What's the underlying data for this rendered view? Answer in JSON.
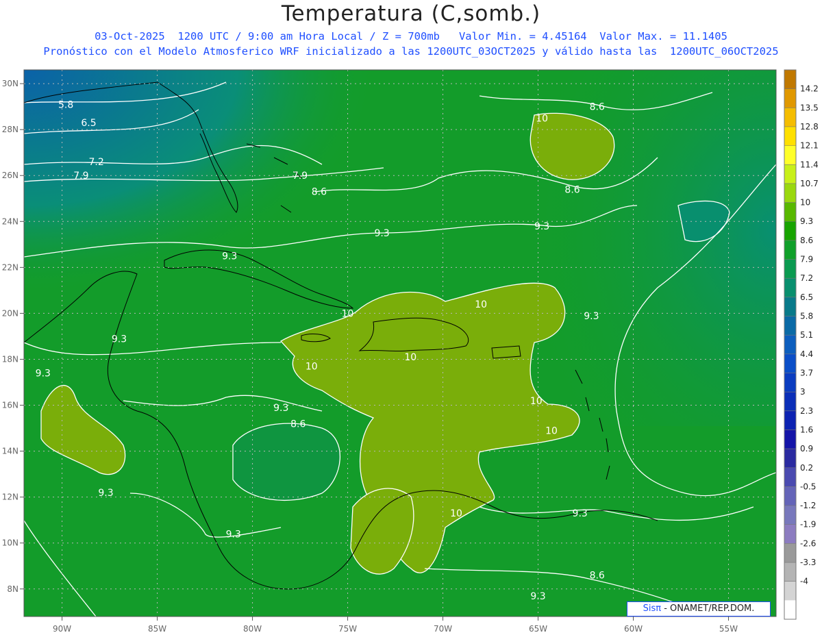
{
  "title": "Temperatura (C,somb.)",
  "subtitle1": "03-Oct-2025  1200 UTC / 9:00 am Hora Local / Z = 700mb   Valor Min. = 4.45164  Valor Max. = 11.1405",
  "subtitle2": "Pronóstico con el Modelo Atmosferico WRF inicializado a las 1200UTC_03OCT2025 y válido hasta las  1200UTC_06OCT2025",
  "credit": {
    "brand": "Sisπ",
    "org": " - ONAMET/REP.DOM."
  },
  "map": {
    "lon_range": [
      -92,
      -52.5
    ],
    "lat_range": [
      6.8,
      30.6
    ],
    "lon_ticks": [
      {
        "value": -90,
        "label": "90W"
      },
      {
        "value": -85,
        "label": "85W"
      },
      {
        "value": -80,
        "label": "80W"
      },
      {
        "value": -75,
        "label": "75W"
      },
      {
        "value": -70,
        "label": "70W"
      },
      {
        "value": -65,
        "label": "65W"
      },
      {
        "value": -60,
        "label": "60W"
      },
      {
        "value": -55,
        "label": "55W"
      }
    ],
    "lat_ticks": [
      {
        "value": 8,
        "label": "8N"
      },
      {
        "value": 10,
        "label": "10N"
      },
      {
        "value": 12,
        "label": "12N"
      },
      {
        "value": 14,
        "label": "14N"
      },
      {
        "value": 16,
        "label": "16N"
      },
      {
        "value": 18,
        "label": "18N"
      },
      {
        "value": 20,
        "label": "20N"
      },
      {
        "value": 22,
        "label": "22N"
      },
      {
        "value": 24,
        "label": "24N"
      },
      {
        "value": 26,
        "label": "26N"
      },
      {
        "value": 28,
        "label": "28N"
      },
      {
        "value": 30,
        "label": "30N"
      }
    ],
    "contour_labels": [
      {
        "text": "5.8",
        "lon": -89.8,
        "lat": 29.1
      },
      {
        "text": "6.5",
        "lon": -88.6,
        "lat": 28.3
      },
      {
        "text": "7.2",
        "lon": -88.2,
        "lat": 26.6
      },
      {
        "text": "7.9",
        "lon": -89.0,
        "lat": 26.0
      },
      {
        "text": "7.9",
        "lon": -77.5,
        "lat": 26.0
      },
      {
        "text": "8.6",
        "lon": -76.5,
        "lat": 25.3
      },
      {
        "text": "8.6",
        "lon": -61.9,
        "lat": 29.0
      },
      {
        "text": "10",
        "lon": -64.8,
        "lat": 28.5
      },
      {
        "text": "8.6",
        "lon": -63.2,
        "lat": 25.4
      },
      {
        "text": "9.3",
        "lon": -64.8,
        "lat": 23.8
      },
      {
        "text": "9.3",
        "lon": -73.2,
        "lat": 23.5
      },
      {
        "text": "9.3",
        "lon": -81.2,
        "lat": 22.5
      },
      {
        "text": "10",
        "lon": -75.0,
        "lat": 20.0
      },
      {
        "text": "10",
        "lon": -68.0,
        "lat": 20.4
      },
      {
        "text": "9.3",
        "lon": -62.2,
        "lat": 19.9
      },
      {
        "text": "9.3",
        "lon": -87.0,
        "lat": 18.9
      },
      {
        "text": "9.3",
        "lon": -91.0,
        "lat": 17.4
      },
      {
        "text": "10",
        "lon": -76.9,
        "lat": 17.7
      },
      {
        "text": "10",
        "lon": -71.7,
        "lat": 18.1
      },
      {
        "text": "10",
        "lon": -65.1,
        "lat": 16.2
      },
      {
        "text": "9.3",
        "lon": -78.5,
        "lat": 15.9
      },
      {
        "text": "8.6",
        "lon": -77.6,
        "lat": 15.2
      },
      {
        "text": "10",
        "lon": -64.3,
        "lat": 14.9
      },
      {
        "text": "9.3",
        "lon": -87.7,
        "lat": 12.2
      },
      {
        "text": "10",
        "lon": -69.3,
        "lat": 11.3
      },
      {
        "text": "9.3",
        "lon": -62.8,
        "lat": 11.3
      },
      {
        "text": "9.3",
        "lon": -81.0,
        "lat": 10.4
      },
      {
        "text": "8.6",
        "lon": -61.9,
        "lat": 8.6
      },
      {
        "text": "9.3",
        "lon": -65.0,
        "lat": 7.7
      }
    ]
  },
  "colorbar": {
    "labels": [
      "14.2",
      "13.5",
      "12.8",
      "12.1",
      "11.4",
      "10.7",
      "10",
      "9.3",
      "8.6",
      "7.9",
      "7.2",
      "6.5",
      "5.8",
      "5.1",
      "4.4",
      "3.7",
      "3",
      "2.3",
      "1.6",
      "0.9",
      "0.2",
      "-0.5",
      "-1.2",
      "-1.9",
      "-2.6",
      "-3.3",
      "-4"
    ],
    "colors": [
      "#c07800",
      "#e09800",
      "#f5bd00",
      "#ffe000",
      "#ffff2a",
      "#c8f019",
      "#9ad80e",
      "#58b800",
      "#17a400",
      "#10a02a",
      "#0a9a50",
      "#088f6e",
      "#087a8a",
      "#0a6aa6",
      "#0c5ebe",
      "#0a4ec8",
      "#0a3cc0",
      "#0a2eb8",
      "#0c22b2",
      "#1414a8",
      "#2a2aa0",
      "#4a4ab0",
      "#6464b8",
      "#7878bc",
      "#8c7cc0",
      "#9a9a9a",
      "#b4b4b4",
      "#d4d4d4",
      "#ffffff"
    ]
  },
  "colors": {
    "field_low": "#0a6aa6",
    "field_mid": "#139c2a",
    "field_high": "#7aae0a",
    "contour": "#ffffff",
    "coast": "#000000",
    "grid": "#b8b8b8"
  }
}
